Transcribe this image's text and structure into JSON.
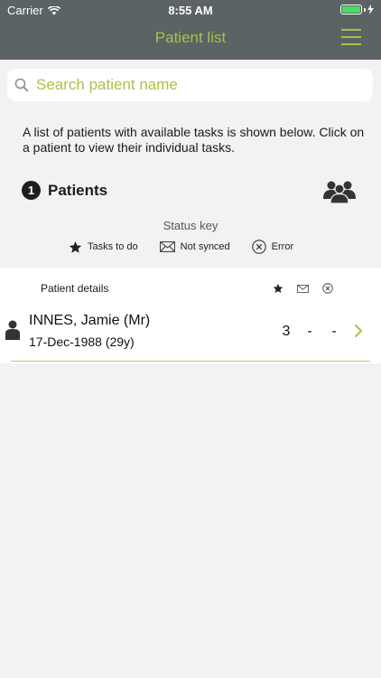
{
  "status_bar": {
    "carrier": "Carrier",
    "time": "8:55 AM"
  },
  "header": {
    "title": "Patient list",
    "menu_icon": "hamburger-menu-icon"
  },
  "search": {
    "placeholder": "Search patient name",
    "icon": "search-icon"
  },
  "intro": {
    "text": "A list of patients with available tasks is shown below. Click on a patient to view their individual tasks."
  },
  "patients_section": {
    "count": "1",
    "label": "Patients",
    "icon": "patient-group-icon"
  },
  "status_key": {
    "title": "Status key",
    "items": [
      {
        "icon": "star-icon",
        "label": "Tasks to do"
      },
      {
        "icon": "envelope-icon",
        "label": "Not synced"
      },
      {
        "icon": "error-circle-icon",
        "label": "Error"
      }
    ]
  },
  "table": {
    "header_label": "Patient details",
    "column_icons": [
      "star-icon",
      "envelope-icon",
      "error-circle-icon"
    ],
    "rows": [
      {
        "name": "INNES, Jamie (Mr)",
        "dob": "17-Dec-1988 (29y)",
        "tasks_to_do": "3",
        "not_synced": "-",
        "error": "-"
      }
    ]
  },
  "colors": {
    "header_bg": "#5b6365",
    "accent": "#a9c24a",
    "page_bg": "#f2f2f2",
    "battery": "#4cd964"
  }
}
